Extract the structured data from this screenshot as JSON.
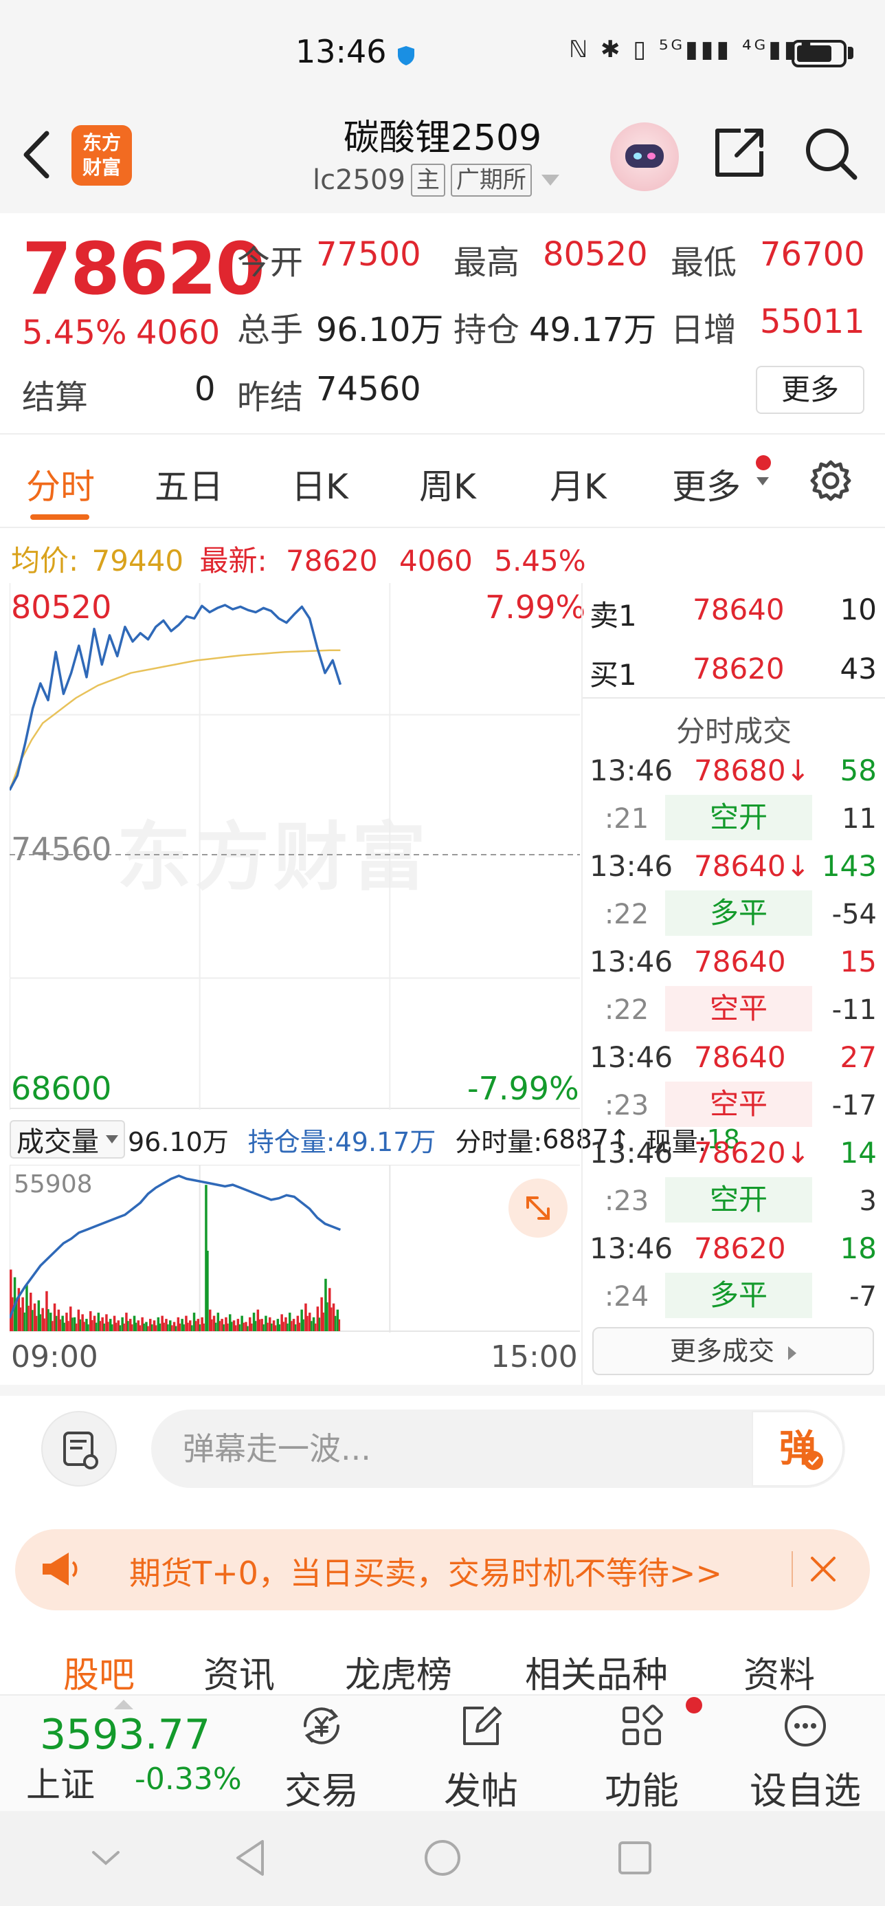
{
  "status_bar": {
    "time": "13:46",
    "icons": "ℕ ✱ ▯ ⁵ᴳ▮▮▮ ⁴ᴳ▮▮▮"
  },
  "header": {
    "title": "碳酸锂2509",
    "code": "lc2509",
    "tag_main": "主",
    "tag_exchange": "广期所",
    "logo_line1": "东方",
    "logo_line2": "财富"
  },
  "quote": {
    "price": "78620",
    "change_pct": "5.45%",
    "change": "4060",
    "open_label": "今开",
    "open": "77500",
    "high_label": "最高",
    "high": "80520",
    "low_label": "最低",
    "low": "76700",
    "volume_label": "总手",
    "volume": "96.10万",
    "oi_label": "持仓",
    "oi": "49.17万",
    "daily_inc_label": "日增",
    "daily_inc": "55011",
    "settle_label": "结算",
    "settle": "0",
    "prev_settle_label": "昨结",
    "prev_settle": "74560",
    "more": "更多"
  },
  "tabs": [
    "分时",
    "五日",
    "日K",
    "周K",
    "月K",
    "更多"
  ],
  "info_line": {
    "avg_label": "均价:",
    "avg": "79440",
    "latest_label": "最新:",
    "latest": "78620",
    "chg": "4060",
    "pct": "5.45%"
  },
  "chart_labels": {
    "high": "80520",
    "high_pct": "7.99%",
    "mid": "74560",
    "low": "68600",
    "low_pct": "-7.99%",
    "watermark": "东方财富",
    "time_start": "09:00",
    "time_end": "15:00"
  },
  "volume_row": {
    "select": "成交量",
    "vol": "96.10万",
    "oi_label": "持仓量:",
    "oi": "49.17万",
    "tick_label": "分时量:",
    "tick": "6887↑",
    "cur_label": "现量:",
    "cur": "18",
    "max": "55908"
  },
  "order_book": {
    "ask": {
      "label": "卖1",
      "price": "78640",
      "vol": "10"
    },
    "bid": {
      "label": "买1",
      "price": "78620",
      "vol": "43"
    },
    "trades_title": "分时成交",
    "trades": [
      {
        "time": "13:46",
        "price": "78680↓",
        "vol": "58",
        "sec": ":21",
        "type": "空开",
        "delta": "11",
        "type_color": "green"
      },
      {
        "time": "13:46",
        "price": "78640↓",
        "vol": "143",
        "sec": ":22",
        "type": "多平",
        "delta": "-54",
        "type_color": "green"
      },
      {
        "time": "13:46",
        "price": "78640",
        "vol": "15",
        "sec": ":22",
        "type": "空平",
        "delta": "-11",
        "type_color": "red"
      },
      {
        "time": "13:46",
        "price": "78640",
        "vol": "27",
        "sec": ":23",
        "type": "空平",
        "delta": "-17",
        "type_color": "red"
      },
      {
        "time": "13:46",
        "price": "78620↓",
        "vol": "14",
        "sec": ":23",
        "type": "空开",
        "delta": "3",
        "type_color": "green"
      },
      {
        "time": "13:46",
        "price": "78620",
        "vol": "18",
        "sec": ":24",
        "type": "多平",
        "delta": "-7",
        "type_color": "green"
      }
    ],
    "more_trades": "更多成交"
  },
  "danmaku": {
    "placeholder": "弹幕走一波...",
    "button": "弹"
  },
  "banner": {
    "text": "期货T+0，当日买卖，交易时机不等待>>"
  },
  "bottom_tabs": [
    "股吧",
    "资讯",
    "龙虎榜",
    "相关品种",
    "资料"
  ],
  "bottom_nav": {
    "index_value": "3593.77",
    "index_name": "上证",
    "index_pct": "-0.33%",
    "items": [
      "交易",
      "发帖",
      "功能",
      "设自选"
    ]
  },
  "colors": {
    "up": "#e0262f",
    "down": "#139a2b",
    "accent": "#f06a1a",
    "price_line": "#2f69b8",
    "avg_line": "#e8c25a"
  },
  "chart_data": {
    "type": "line",
    "ylim": [
      68600,
      80520
    ],
    "reference": 74560,
    "series": [
      {
        "values": [
          76100,
          76450,
          77200,
          78050,
          78650,
          78250,
          79400,
          78400,
          78900,
          79550,
          78800,
          79950,
          79100,
          79800,
          79300,
          80000,
          79650,
          79850,
          79700,
          80000,
          80150,
          79900,
          80050,
          80250,
          80200,
          80500,
          80350,
          80450,
          80520,
          80420,
          80480,
          80400,
          80350,
          80450,
          80380,
          80200,
          80100,
          80300,
          80480,
          80200,
          79500,
          78900,
          79200,
          78620
        ]
      },
      {
        "values": [
          76100,
          76800,
          77300,
          77700,
          77900,
          78100,
          78300,
          78450,
          78600,
          78700,
          78800,
          78900,
          78950,
          79000,
          79050,
          79100,
          79150,
          79200,
          79230,
          79260,
          79290,
          79320,
          79340,
          79360,
          79380,
          79400,
          79410,
          79420,
          79430,
          79440,
          79440
        ]
      }
    ],
    "volume": [
      40,
      35,
      28,
      22,
      30,
      25,
      18,
      20,
      15,
      26,
      12,
      18,
      14,
      10,
      12,
      16,
      9,
      14,
      11,
      8,
      13,
      10,
      12,
      9,
      11,
      8,
      10,
      7,
      9,
      12,
      8,
      10,
      7,
      9,
      6,
      8,
      7,
      9,
      10,
      8,
      7,
      6,
      9,
      8,
      10,
      7,
      12,
      8,
      9,
      95,
      14,
      10,
      12,
      8,
      9,
      11,
      7,
      8,
      10,
      6,
      9,
      12,
      14,
      8,
      10,
      9,
      7,
      8,
      11,
      9,
      12,
      8,
      10,
      14,
      18,
      12,
      9,
      16,
      22,
      34,
      28,
      18,
      14
    ],
    "oi_curve": [
      5,
      18,
      26,
      33,
      40,
      45,
      50,
      55,
      58,
      62,
      64,
      66,
      68,
      70,
      72,
      74,
      78,
      82,
      88,
      92,
      95,
      98,
      100,
      98,
      97,
      96,
      95,
      94,
      93,
      94,
      92,
      90,
      88,
      86,
      84,
      85,
      87,
      86,
      82,
      78,
      72,
      68,
      66,
      64
    ]
  }
}
